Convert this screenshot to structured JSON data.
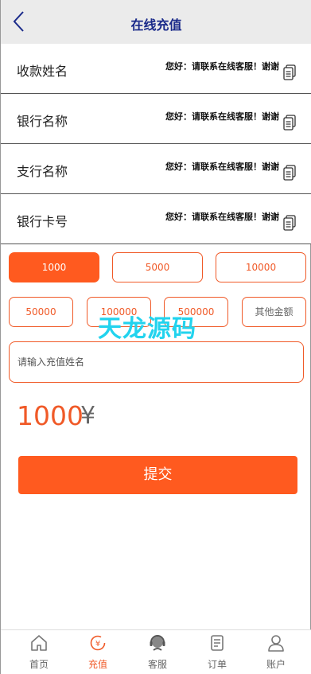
{
  "header": {
    "title": "在线充值"
  },
  "info_rows": [
    {
      "label": "收款姓名",
      "value": "您好：请联系在线客服！谢谢"
    },
    {
      "label": "银行名称",
      "value": "您好：请联系在线客服！谢谢"
    },
    {
      "label": "支行名称",
      "value": "您好：请联系在线客服！谢谢"
    },
    {
      "label": "银行卡号",
      "value": "您好：请联系在线客服！谢谢"
    }
  ],
  "amounts": {
    "row1": [
      "1000",
      "5000",
      "10000"
    ],
    "row2": [
      "50000",
      "100000",
      "500000"
    ],
    "other_label": "其他金额",
    "selected": "1000"
  },
  "name_input": {
    "placeholder": "请输入充值姓名",
    "value": ""
  },
  "watermark": "天龙源码",
  "amount_display": {
    "value": "1000",
    "currency": "¥"
  },
  "submit_label": "提交",
  "tabbar": [
    {
      "label": "首页",
      "icon": "home-icon"
    },
    {
      "label": "充值",
      "icon": "recharge-icon",
      "active": true
    },
    {
      "label": "客服",
      "icon": "customer-service-icon"
    },
    {
      "label": "订单",
      "icon": "order-icon"
    },
    {
      "label": "账户",
      "icon": "account-icon"
    }
  ],
  "colors": {
    "accent": "#ff5a1f",
    "title": "#1a2a8a",
    "watermark": "#22d3ee"
  }
}
